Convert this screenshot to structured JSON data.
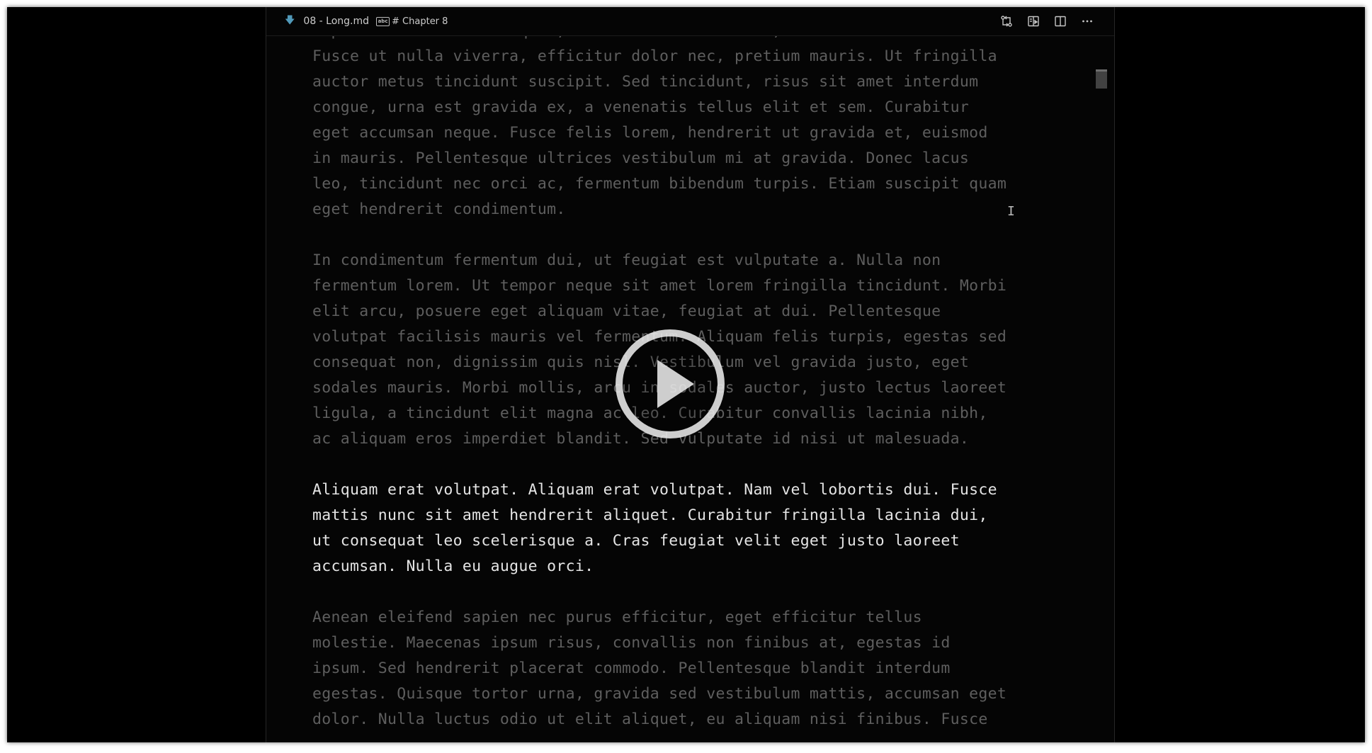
{
  "window": {
    "breadcrumb": {
      "file_icon": "markdown-icon",
      "file_name": "08 - Long.md",
      "section_icon": "heading-symbol-icon",
      "section_icon_text": "abc",
      "heading": "# Chapter 8"
    },
    "actions": [
      {
        "name": "open-changes-icon"
      },
      {
        "name": "open-preview-to-side-icon"
      },
      {
        "name": "split-editor-icon"
      },
      {
        "name": "more-actions-icon"
      }
    ]
  },
  "editor": {
    "paragraphs": [
      {
        "active": false,
        "lines": [
          "imperdiet. Cras dolor quam, rhoncus ut finibus in, efficitur in nulla.",
          "Fusce ut nulla viverra, efficitur dolor nec, pretium mauris. Ut fringilla",
          "auctor metus tincidunt suscipit. Sed tincidunt, risus sit amet interdum",
          "congue, urna est gravida ex, a venenatis tellus elit et sem. Curabitur",
          "eget accumsan neque. Fusce felis lorem, hendrerit ut gravida et, euismod",
          "in mauris. Pellentesque ultrices vestibulum mi at gravida. Donec lacus",
          "leo, tincidunt nec orci ac, fermentum bibendum turpis. Etiam suscipit quam",
          "eget hendrerit condimentum."
        ]
      },
      {
        "active": false,
        "lines": [
          "In condimentum fermentum dui, ut feugiat est vulputate a. Nulla non",
          "fermentum lorem. Ut tempor neque sit amet lorem fringilla tincidunt. Morbi",
          "elit arcu, posuere eget aliquam vitae, feugiat at dui. Pellentesque",
          "volutpat facilisis mauris vel fermentum. Aliquam felis turpis, egestas sed",
          "consequat non, dignissim quis nisl. Vestibulum vel gravida justo, eget",
          "sodales mauris. Morbi mollis, arcu in sodales auctor, justo lectus laoreet",
          "ligula, a tincidunt elit magna ac leo. Curabitur convallis lacinia nibh,",
          "ac aliquam eros imperdiet blandit. Sed vulputate id nisi ut malesuada."
        ]
      },
      {
        "active": true,
        "lines": [
          "Aliquam erat volutpat. Aliquam erat volutpat. Nam vel lobortis dui. Fusce",
          "mattis nunc sit amet hendrerit aliquet. Curabitur fringilla lacinia dui,",
          "ut consequat leo scelerisque a. Cras feugiat velit eget justo laoreet",
          "accumsan. Nulla eu augue orci."
        ]
      },
      {
        "active": false,
        "lines": [
          "Aenean eleifend sapien nec purus efficitur, eget efficitur tellus",
          "molestie. Maecenas ipsum risus, convallis non finibus at, egestas id",
          "ipsum. Sed hendrerit placerat commodo. Pellentesque blandit interdum",
          "egestas. Quisque tortor urna, gravida sed vestibulum mattis, accumsan eget",
          "dolor. Nulla luctus odio ut elit aliquet, eu aliquam nisi finibus. Fusce"
        ]
      }
    ]
  },
  "overlay": {
    "icon": "play-icon"
  }
}
